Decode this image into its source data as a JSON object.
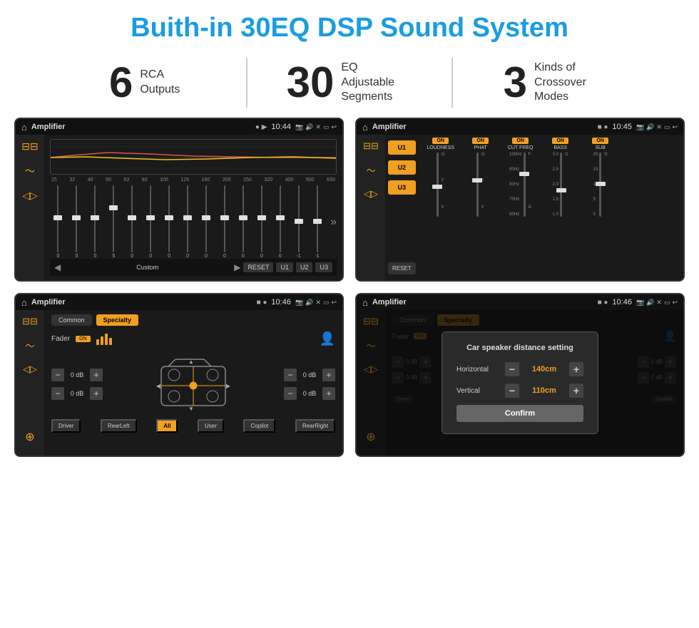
{
  "header": {
    "title": "Buith-in 30EQ DSP Sound System"
  },
  "stats": [
    {
      "number": "6",
      "label": "RCA\nOutputs"
    },
    {
      "number": "30",
      "label": "EQ Adjustable\nSegments"
    },
    {
      "number": "3",
      "label": "Kinds of\nCrossover Modes"
    }
  ],
  "screens": [
    {
      "id": "screen1",
      "status_bar": {
        "app": "Amplifier",
        "time": "10:44"
      },
      "eq_freqs": [
        "25",
        "32",
        "40",
        "50",
        "63",
        "80",
        "100",
        "125",
        "160",
        "200",
        "250",
        "320",
        "400",
        "500",
        "630"
      ],
      "eq_values": [
        "0",
        "0",
        "0",
        "5",
        "0",
        "0",
        "0",
        "0",
        "0",
        "0",
        "0",
        "0",
        "0",
        "-1",
        "0",
        "-1"
      ],
      "bottom_buttons": [
        "Custom",
        "RESET",
        "U1",
        "U2",
        "U3"
      ]
    },
    {
      "id": "screen2",
      "status_bar": {
        "app": "Amplifier",
        "time": "10:45"
      },
      "u_buttons": [
        "U1",
        "U2",
        "U3"
      ],
      "controls": [
        {
          "label": "LOUDNESS",
          "on": true
        },
        {
          "label": "PHAT",
          "on": true
        },
        {
          "label": "CUT FREQ",
          "on": true
        },
        {
          "label": "BASS",
          "on": true
        },
        {
          "label": "SUB",
          "on": true
        }
      ]
    },
    {
      "id": "screen3",
      "status_bar": {
        "app": "Amplifier",
        "time": "10:46"
      },
      "tabs": [
        "Common",
        "Specialty"
      ],
      "active_tab": "Specialty",
      "fader_label": "Fader",
      "fader_on": "ON",
      "db_controls": [
        {
          "label": "0 dB",
          "pos": "top-left"
        },
        {
          "label": "0 dB",
          "pos": "top-right"
        },
        {
          "label": "0 dB",
          "pos": "bottom-left"
        },
        {
          "label": "0 dB",
          "pos": "bottom-right"
        }
      ],
      "bottom_buttons": [
        "Driver",
        "RearLeft",
        "All",
        "User",
        "Copilot",
        "RearRight"
      ]
    },
    {
      "id": "screen4",
      "status_bar": {
        "app": "Amplifier",
        "time": "10:46"
      },
      "tabs": [
        "Common",
        "Specialty"
      ],
      "dialog": {
        "title": "Car speaker distance setting",
        "horizontal_label": "Horizontal",
        "horizontal_value": "140cm",
        "vertical_label": "Vertical",
        "vertical_value": "110cm",
        "confirm_label": "Confirm"
      },
      "db_controls": [
        {
          "label": "0 dB"
        },
        {
          "label": "0 dB"
        }
      ]
    }
  ]
}
